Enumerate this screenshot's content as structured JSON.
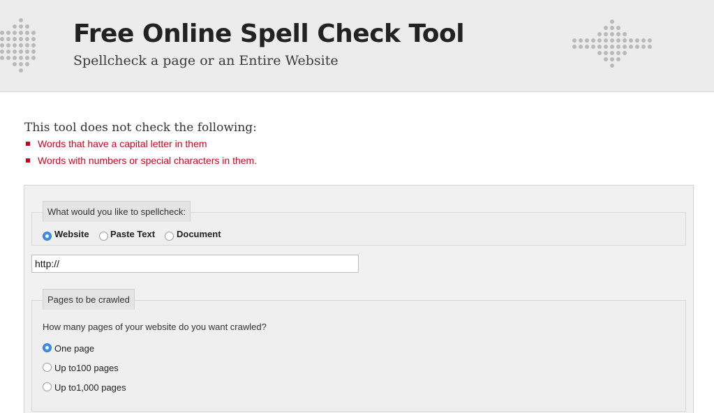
{
  "header": {
    "title": "Free Online Spell Check Tool",
    "subtitle": "Spellcheck a page or an Entire Website"
  },
  "notice": {
    "heading": "This tool does not check the following:",
    "items": [
      "Words that have a capital letter in them",
      "Words with numbers or special characters in them."
    ],
    "color": "#d0021b"
  },
  "spellcheck_type": {
    "legend": "What would you like to spellcheck:",
    "options": [
      "Website",
      "Paste Text",
      "Document"
    ],
    "selected": "Website"
  },
  "url_input": {
    "value": "http://"
  },
  "pages": {
    "legend": "Pages to be crawled",
    "question": "How many pages of your website do you want crawled?",
    "options": [
      "One page",
      "Up to100 pages",
      "Up to1,000 pages"
    ],
    "selected": "One page"
  },
  "colors": {
    "radio_selected": "#3d8ee8",
    "header_bg": "#ececec"
  }
}
